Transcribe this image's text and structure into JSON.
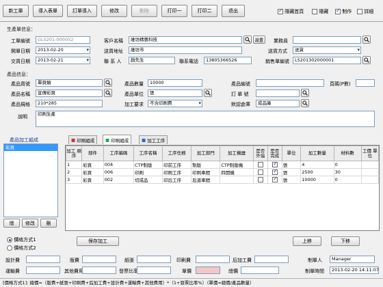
{
  "toolbar": {
    "buttons": [
      {
        "label": "新工單",
        "enabled": true
      },
      {
        "label": "導入表單",
        "enabled": true
      },
      {
        "label": "訂單導入",
        "enabled": true
      },
      {
        "label": "修改",
        "enabled": true
      },
      {
        "label": "刪除",
        "enabled": false
      },
      {
        "label": "打印一",
        "enabled": true
      },
      {
        "label": "打印二",
        "enabled": true
      },
      {
        "label": "退出",
        "enabled": true
      }
    ],
    "options": [
      {
        "label": "隱藏首頁",
        "checked": true
      },
      {
        "label": "隱藏",
        "checked": false
      },
      {
        "label": "制作",
        "checked": true
      },
      {
        "label": "詳細",
        "checked": false
      }
    ]
  },
  "production": {
    "section_title": "生產單信息：",
    "order_no_label": "工單編號",
    "order_no_value": "GLS201-000052",
    "start_date_label": "開單日期",
    "start_date_value": "2013-02-20",
    "delivery_date_label": "交貨日期",
    "delivery_date_value": "2013-02-21",
    "customer_name_label": "客戶名稱",
    "customer_name_value": "維坊精藝科技",
    "customer_addr_label": "送貨地址",
    "customer_addr_value": "維坊市",
    "contact_label": "聯 系 人",
    "contact_value": "趙先生",
    "phone_label": "聯系電話",
    "phone_value": "13805366526",
    "salesman_label": "業務員",
    "salesman_value": "",
    "ship_method_label": "送貨方式",
    "ship_method_value": "送貨",
    "sales_no_label": "銷售單編號",
    "sales_no_value": "LS201302000001",
    "settings_button": "設置"
  },
  "product": {
    "section_title": "產品信息：",
    "code_label": "產品貨號",
    "code_value": "單頁類",
    "name_label": "產品名稱",
    "name_value": "宣傳彩頁",
    "spec_label": "產品規格",
    "spec_value": "210*285",
    "qty_label": "產品數量",
    "qty_value": "10000",
    "unit_label": "產品單位",
    "unit_value": "張",
    "method_label": "加工要求",
    "method_value": "不含印刷費",
    "serial_label": "產品編號",
    "serial_value": "",
    "order_label": "訂 單 號",
    "order_value": "",
    "warehouse_label": "默認倉庫",
    "warehouse_value": "成品庫",
    "page_count_label": "頁碼(P數)",
    "page_count_value": "",
    "notes_label": "說明",
    "notes_value": "印刷生產"
  },
  "left_panel": {
    "title": "產品加工組成",
    "items": [
      "彩頁"
    ],
    "buttons": [
      "增",
      "修改",
      "刪"
    ]
  },
  "tabs": [
    "印刷組成",
    "印刷組成",
    "加工工序"
  ],
  "grid": {
    "headers": [
      "加工\n順序",
      "部件",
      "工序編碼",
      "工序名稱",
      "工序任務",
      "加工部門",
      "加工機器",
      "是否\n外協",
      "是否\n完成",
      "單位",
      "加工數量",
      "材料數",
      "工價\n單位"
    ],
    "rows": [
      [
        "1",
        "彩頁",
        "004",
        "CTP制版",
        "印前工序",
        "制版",
        "CTP制版機",
        "",
        "✓",
        "張",
        "4",
        "0",
        ""
      ],
      [
        "2",
        "彩頁",
        "006",
        "印刷",
        "印刷工序",
        "印刷車間",
        "四開機",
        "",
        "✓",
        "張",
        "2500",
        "30",
        ""
      ],
      [
        "3",
        "彩頁",
        "002",
        "切成品",
        "印后工序",
        "后道車間",
        "",
        "",
        "✓",
        "張",
        "10000",
        "0",
        ""
      ]
    ]
  },
  "bottom": {
    "save_label": "保存加工",
    "radio1": "價格方式1",
    "radio2": "價格方式2",
    "costs": [
      {
        "label": "設計費",
        "value": ""
      },
      {
        "label": "版費",
        "value": ""
      },
      {
        "label": "紙張",
        "value": ""
      },
      {
        "label": "印刷費",
        "value": ""
      },
      {
        "label": "后加工費",
        "value": ""
      },
      {
        "label": "運輸費",
        "value": ""
      },
      {
        "label": "其他費用",
        "value": ""
      },
      {
        "label": "發票比率",
        "value": ""
      },
      {
        "label": "單價",
        "value": ""
      },
      {
        "label": "總價",
        "value": ""
      }
    ],
    "maker_label": "制單人",
    "maker_value": "Manager",
    "make_time_label": "制單時間",
    "make_time_value": "2013-02-20 14:11:07",
    "btn_up": "上移",
    "btn_down": "下移"
  },
  "status": "[價格方式1]: 總價=（版費+紙張+印刷費+后加工費+設計費+運輸費+其他費用）*（1+發票比率%）（單價=總價/產品數量）"
}
